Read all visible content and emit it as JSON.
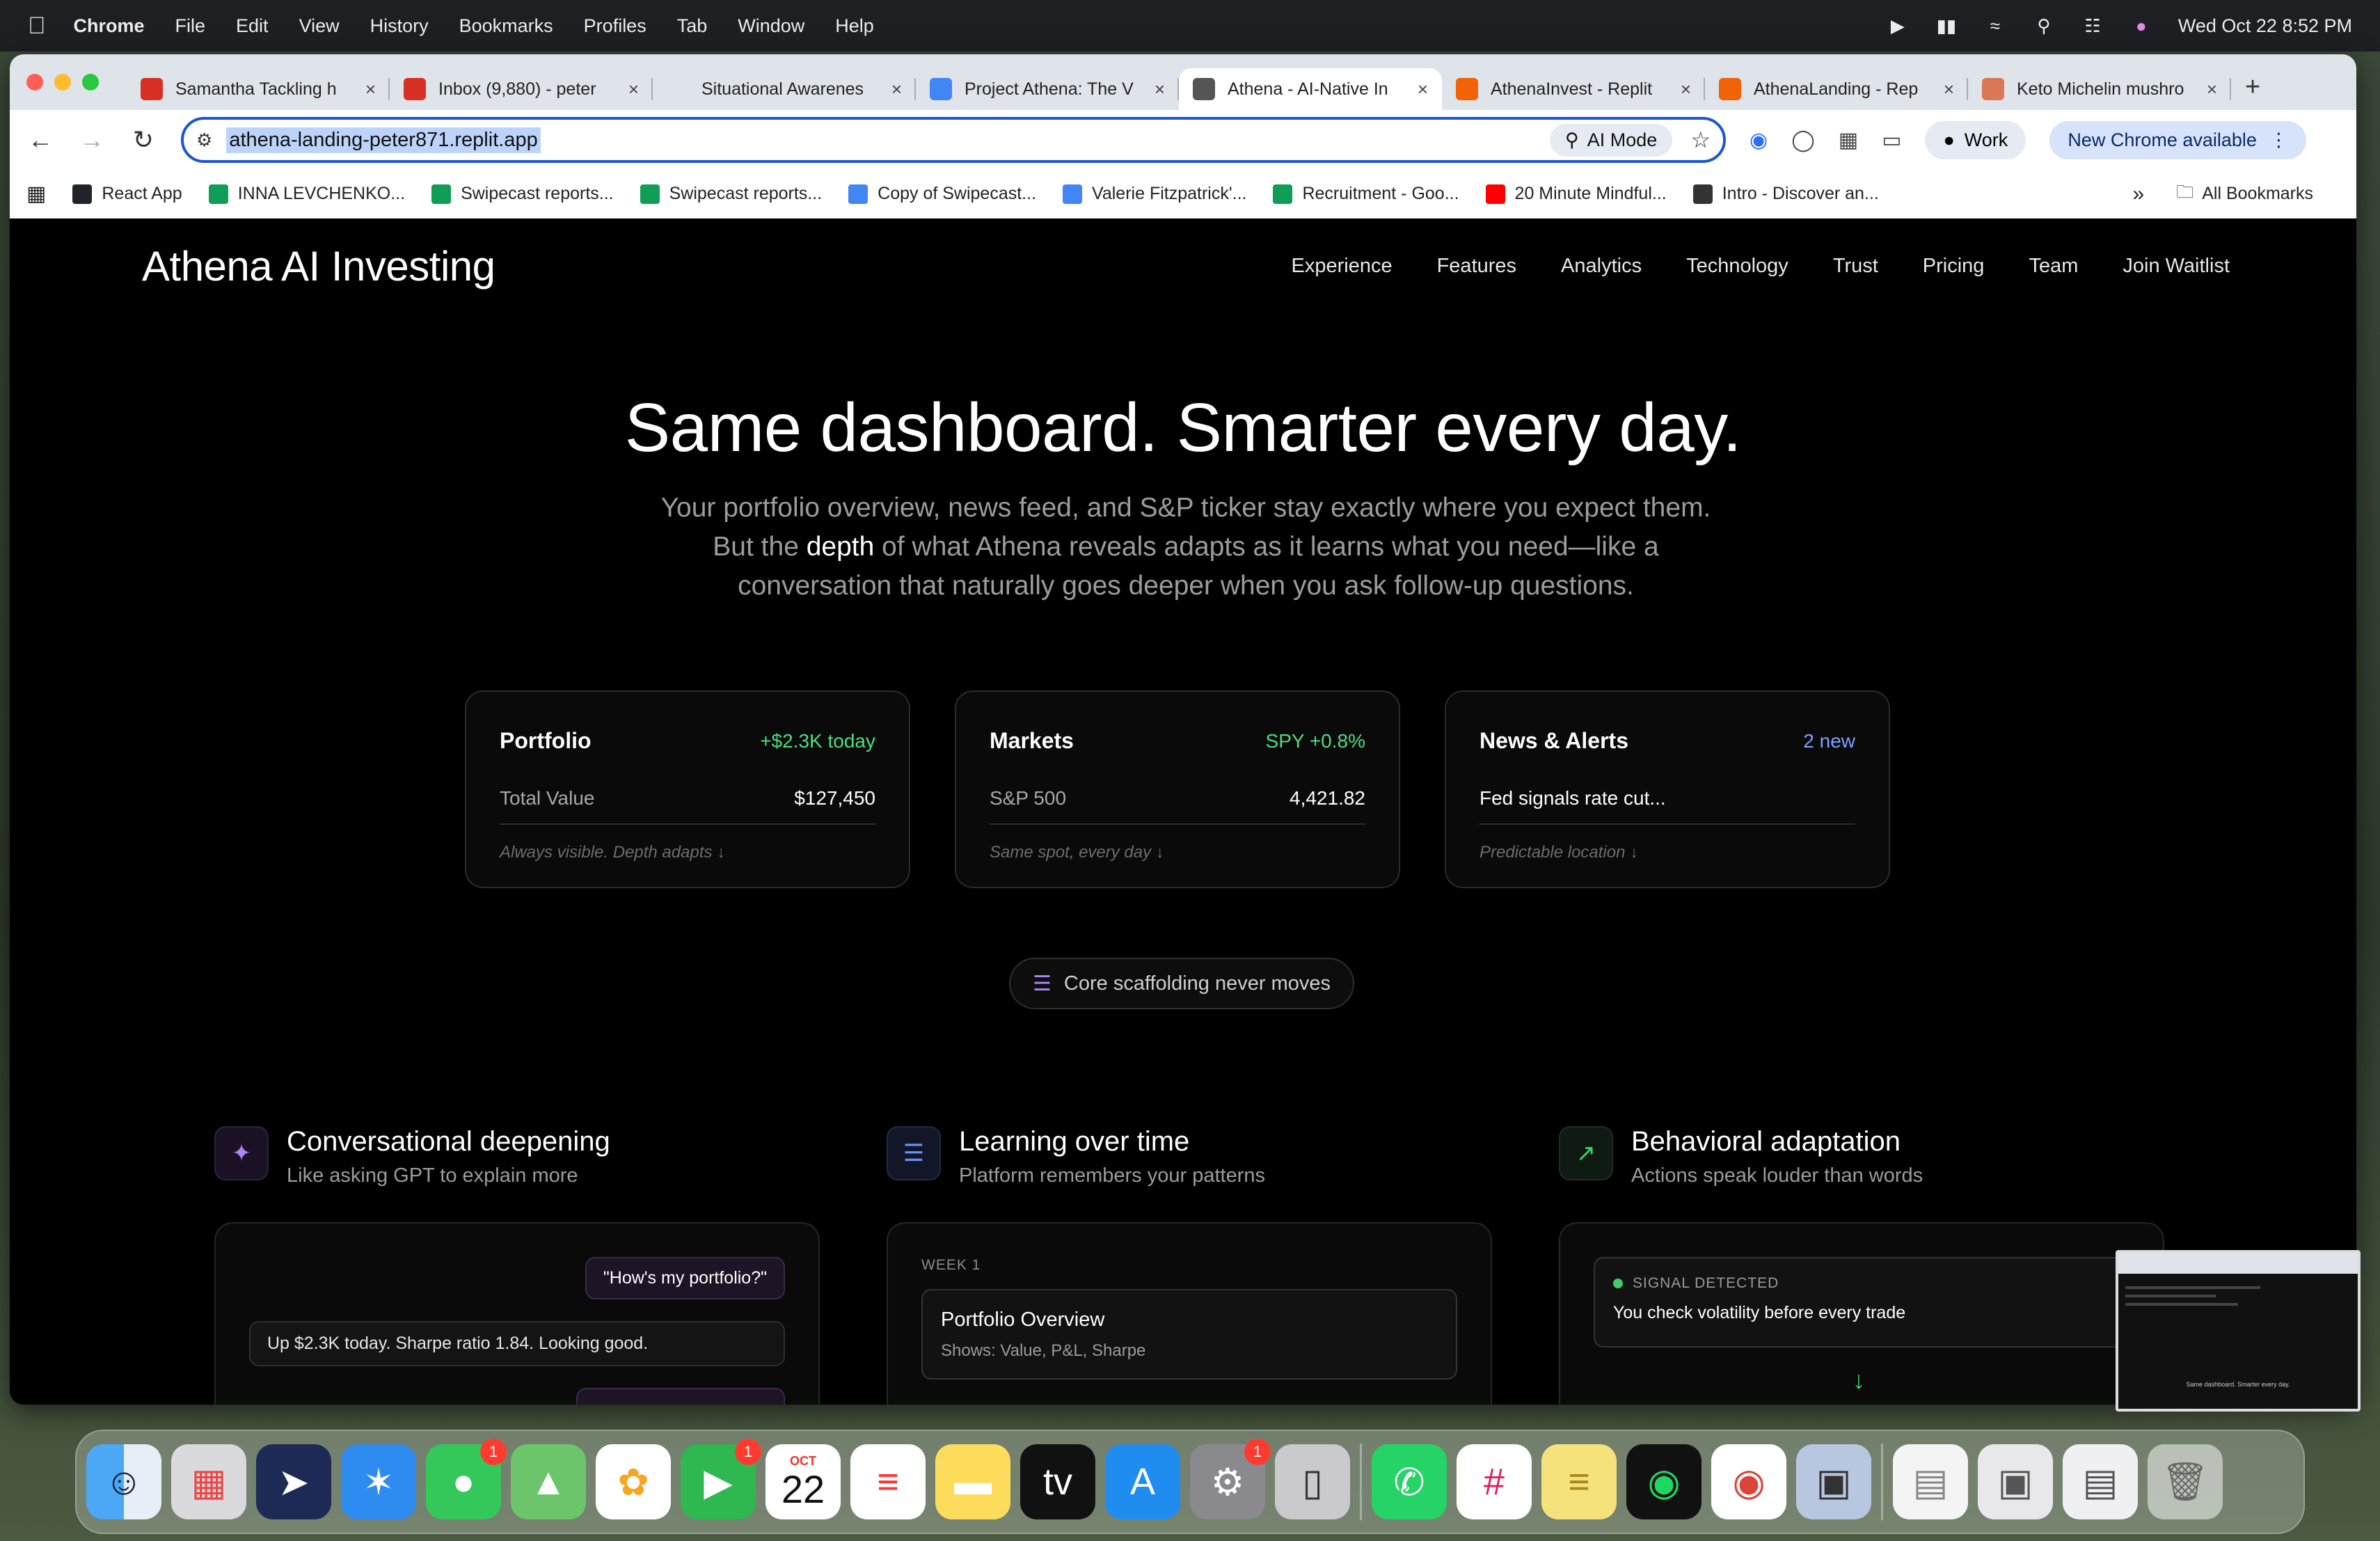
{
  "menubar": {
    "app": "Chrome",
    "items": [
      "File",
      "Edit",
      "View",
      "History",
      "Bookmarks",
      "Profiles",
      "Tab",
      "Window",
      "Help"
    ],
    "clock": "Wed Oct 22  8:52 PM"
  },
  "tabs": [
    {
      "label": "Samantha Tackling h",
      "favicon": "gmail-icon",
      "color": "#d93025",
      "active": false
    },
    {
      "label": "Inbox (9,880) - peter",
      "favicon": "gmail-icon",
      "color": "#d93025",
      "active": false
    },
    {
      "label": "Situational Awarenes",
      "favicon": "blank-icon",
      "color": "#dfe3ea",
      "active": false
    },
    {
      "label": "Project Athena: The V",
      "favicon": "docs-icon",
      "color": "#4285f4",
      "active": false
    },
    {
      "label": "Athena - AI-Native In",
      "favicon": "globe-icon",
      "color": "#555555",
      "active": true
    },
    {
      "label": "AthenaInvest - Replit",
      "favicon": "replit-icon",
      "color": "#f26207",
      "active": false
    },
    {
      "label": "AthenaLanding - Rep",
      "favicon": "replit-icon",
      "color": "#f26207",
      "active": false
    },
    {
      "label": "Keto Michelin mushro",
      "favicon": "claude-icon",
      "color": "#d97757",
      "active": false
    }
  ],
  "toolbar": {
    "url": "athena-landing-peter871.replit.app",
    "ai_mode": "AI Mode",
    "profile": "Work",
    "update": "New Chrome available"
  },
  "bookmarks": [
    {
      "label": "React App",
      "color": "#20232a"
    },
    {
      "label": "INNA LEVCHENKO...",
      "color": "#0f9d58"
    },
    {
      "label": "Swipecast reports...",
      "color": "#0f9d58"
    },
    {
      "label": "Swipecast reports...",
      "color": "#0f9d58"
    },
    {
      "label": "Copy of Swipecast...",
      "color": "#4285f4"
    },
    {
      "label": "Valerie Fitzpatrick'...",
      "color": "#4285f4"
    },
    {
      "label": "Recruitment - Goo...",
      "color": "#0f9d58"
    },
    {
      "label": "20 Minute Mindful...",
      "color": "#ff0000"
    },
    {
      "label": "Intro - Discover an...",
      "color": "#333333"
    }
  ],
  "all_bookmarks": "All Bookmarks",
  "site": {
    "logo": "Athena AI Investing",
    "nav": [
      "Experience",
      "Features",
      "Analytics",
      "Technology",
      "Trust",
      "Pricing",
      "Team",
      "Join Waitlist"
    ],
    "hero_title": "Same dashboard. Smarter every day.",
    "hero_sub_1": "Your portfolio overview, news feed, and S&P ticker stay exactly where you expect them. But the ",
    "hero_sub_hl": "depth",
    "hero_sub_2": " of what Athena reveals adapts as it learns what you need—like a conversation that naturally goes deeper when you ask follow-up questions.",
    "cards": [
      {
        "title": "Portfolio",
        "badge": "+$2.3K today",
        "badge_color": "#4ade80",
        "label": "Total Value",
        "value": "$127,450",
        "note": "Always visible. Depth adapts ↓"
      },
      {
        "title": "Markets",
        "badge": "SPY +0.8%",
        "badge_color": "#4ade80",
        "label": "S&P 500",
        "value": "4,421.82",
        "note": "Same spot, every day ↓"
      },
      {
        "title": "News & Alerts",
        "badge": "2 new",
        "badge_color": "#7aa2ff",
        "label": "Fed signals rate cut...",
        "value": "",
        "note": "Predictable location ↓"
      }
    ],
    "scaffold_pill": "Core scaffolding never moves",
    "features": [
      {
        "title": "Conversational deepening",
        "sub": "Like asking GPT to explain more",
        "icon": "brain-icon",
        "accent": "#b084f5"
      },
      {
        "title": "Learning over time",
        "sub": "Platform remembers your patterns",
        "icon": "layers-icon",
        "accent": "#6b8df5"
      },
      {
        "title": "Behavioral adaptation",
        "sub": "Actions speak louder than words",
        "icon": "trending-up-icon",
        "accent": "#3fce6b"
      }
    ],
    "chat": {
      "question": "\"How's my portfolio?\"",
      "answer": "Up $2.3K today. Sharpe ratio 1.84. Looking good."
    },
    "week": {
      "label": "WEEK 1",
      "title": "Portfolio Overview",
      "sub": "Shows: Value, P&L, Sharpe"
    },
    "signal": {
      "tag": "SIGNAL DETECTED",
      "text": "You check volatility before every trade"
    }
  },
  "thumbnail_caption": "Same dashboard. Smarter every day.",
  "dock": {
    "calendar_month": "OCT",
    "calendar_day": "22",
    "badges": {
      "messages": "1",
      "facetime": "1",
      "settings": "1"
    }
  }
}
